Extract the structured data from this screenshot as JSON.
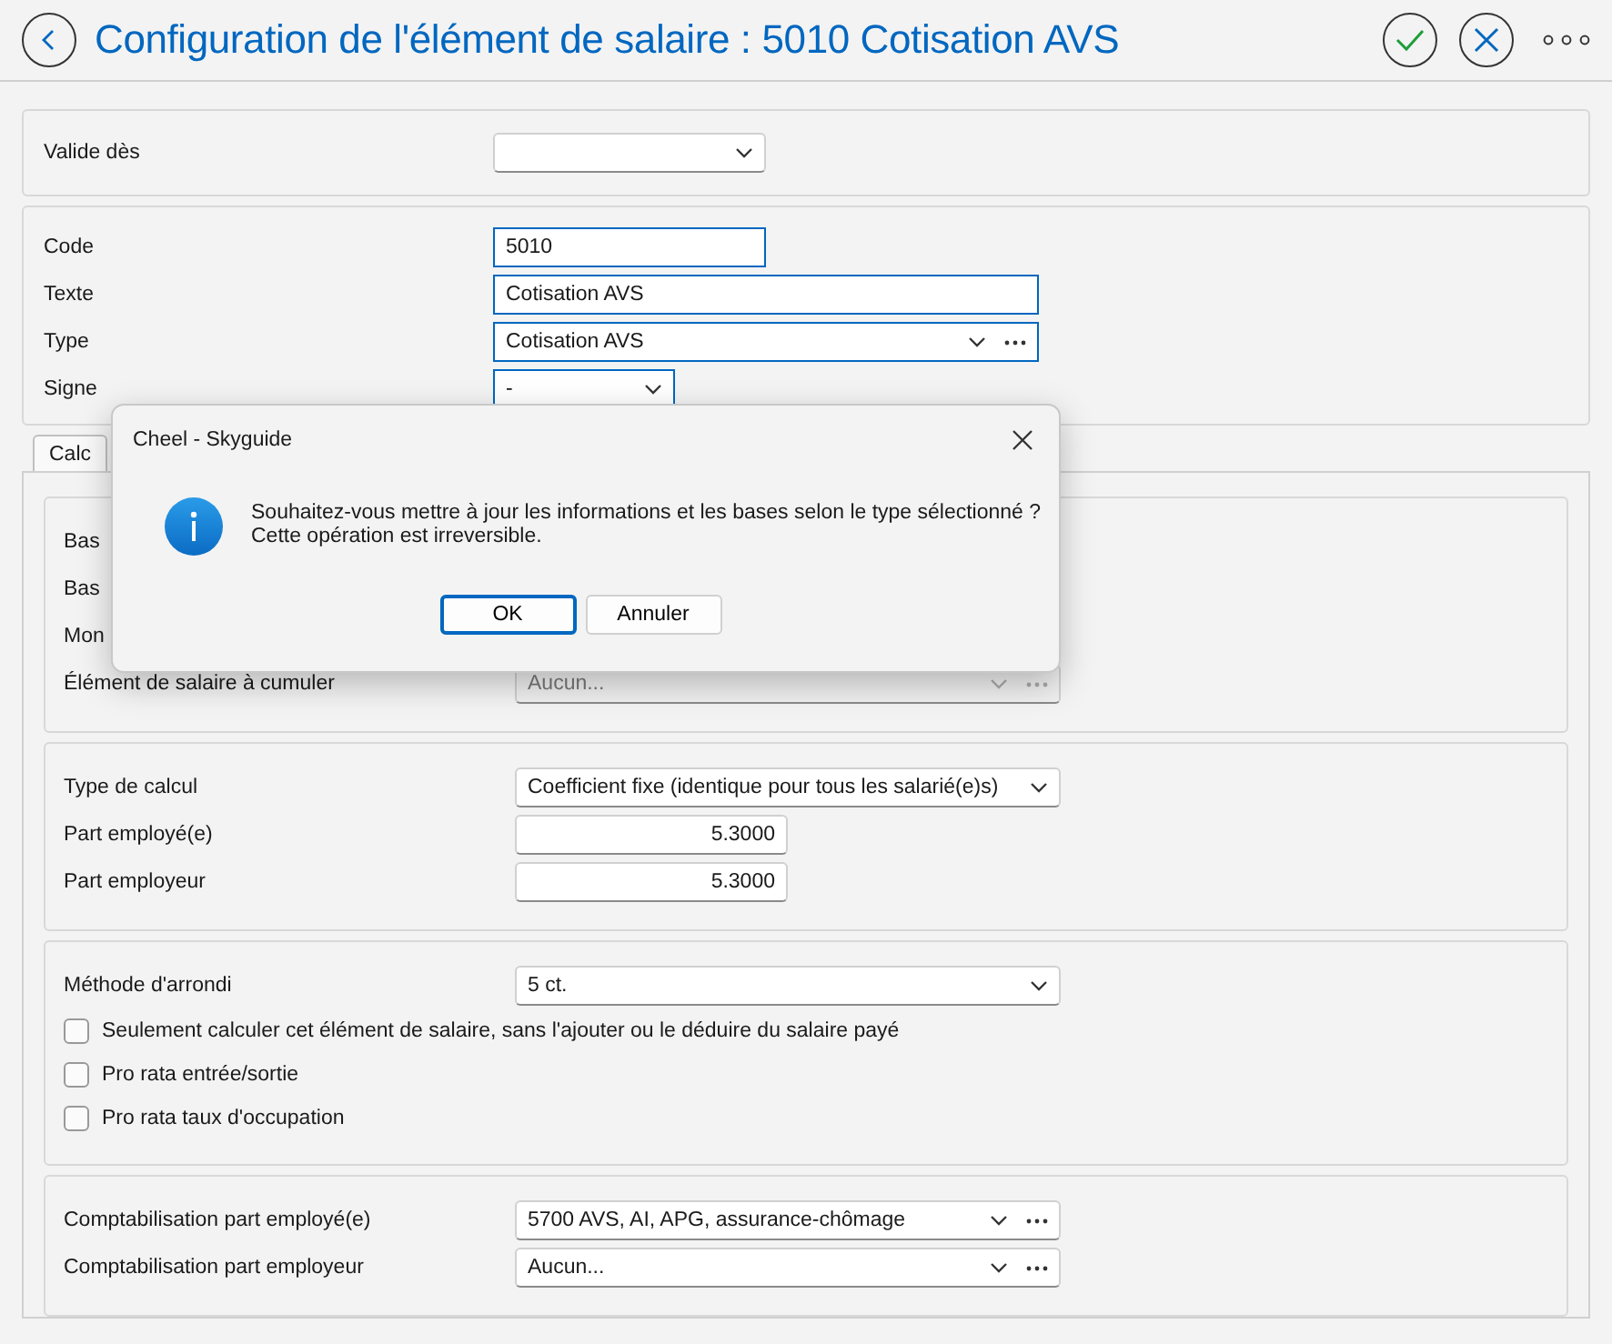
{
  "header": {
    "title": "Configuration de l'élément de salaire : 5010 Cotisation AVS"
  },
  "sections": [
    {
      "rows": [
        {
          "label": "Valide dès",
          "kind": "select",
          "value": "",
          "highlighted": false
        }
      ]
    },
    {
      "rows": [
        {
          "label": "Code",
          "kind": "text",
          "value": "5010",
          "highlighted": true
        },
        {
          "label": "Texte",
          "kind": "text",
          "value": "Cotisation AVS",
          "highlighted": true
        },
        {
          "label": "Type",
          "kind": "select_more",
          "value": "Cotisation AVS",
          "highlighted": true
        },
        {
          "label": "Signe",
          "kind": "select",
          "value": "-",
          "highlighted": true
        }
      ]
    }
  ],
  "tabs": [
    {
      "label": "Calc",
      "selected": true
    }
  ],
  "groups": [
    {
      "rows": [
        {
          "label": "Bas",
          "kind": "label"
        },
        {
          "label": "Bas",
          "kind": "label"
        },
        {
          "label": "Mon",
          "kind": "label"
        },
        {
          "label": "Élément de salaire à cumuler",
          "kind": "select_more",
          "value": "Aucun...",
          "disabled": true
        }
      ]
    },
    {
      "rows": [
        {
          "label": "Type de calcul",
          "kind": "select",
          "value": "Coefficient fixe (identique pour tous les salarié(e)s)",
          "disabled": false
        },
        {
          "label": "Part employé(e)",
          "kind": "number",
          "value": "5.3000",
          "disabled": false
        },
        {
          "label": "Part employeur",
          "kind": "number",
          "value": "5.3000",
          "disabled": false
        }
      ]
    },
    {
      "rows": [
        {
          "label": "Méthode d'arrondi",
          "kind": "select",
          "value": "5 ct.",
          "disabled": false
        },
        {
          "label": "Seulement calculer cet élément de salaire, sans l'ajouter ou le déduire du salaire payé",
          "kind": "checkbox",
          "checked": false
        },
        {
          "label": "Pro rata entrée/sortie",
          "kind": "checkbox",
          "checked": false
        },
        {
          "label": "Pro rata taux d'occupation",
          "kind": "checkbox",
          "checked": false
        }
      ]
    },
    {
      "rows": [
        {
          "label": "Comptabilisation part employé(e)",
          "kind": "select_more",
          "value": "5700 AVS, AI, APG, assurance-chômage",
          "disabled": false
        },
        {
          "label": "Comptabilisation part employeur",
          "kind": "select_more",
          "value": "Aucun...",
          "disabled": false
        }
      ]
    }
  ],
  "dialog": {
    "title": "Cheel - Skyguide",
    "message_lines": [
      "Souhaitez-vous mettre à jour les informations et les bases selon le type sélectionné ?",
      "Cette opération est irreversible."
    ],
    "buttons": [
      {
        "label": "OK",
        "default": true
      },
      {
        "label": "Annuler",
        "default": false
      }
    ]
  }
}
